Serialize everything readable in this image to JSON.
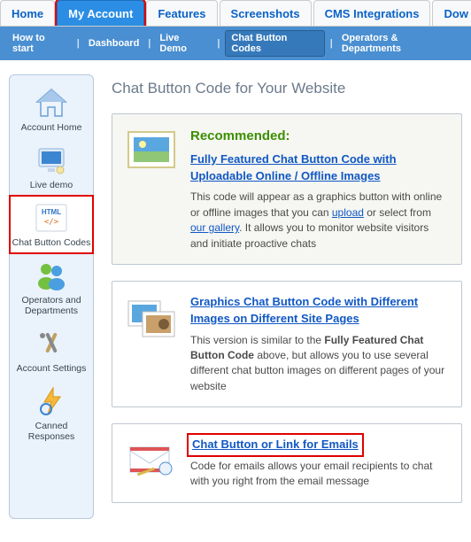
{
  "topnav": {
    "tabs": [
      {
        "label": "Home",
        "active": false
      },
      {
        "label": "My Account",
        "active": true,
        "redbox": true
      },
      {
        "label": "Features",
        "active": false
      },
      {
        "label": "Screenshots",
        "active": false
      },
      {
        "label": "CMS Integrations",
        "active": false
      },
      {
        "label": "Dow",
        "active": false
      }
    ]
  },
  "subnav": {
    "items": [
      {
        "label": "How to start"
      },
      {
        "label": "Dashboard"
      },
      {
        "label": "Live Demo"
      },
      {
        "label": "Chat Button Codes",
        "current": true
      },
      {
        "label": "Operators & Departments"
      }
    ]
  },
  "sidebar": {
    "items": [
      {
        "id": "account-home",
        "label": "Account Home",
        "icon": "home-icon"
      },
      {
        "id": "live-demo",
        "label": "Live demo",
        "icon": "monitor-icon"
      },
      {
        "id": "chat-button-codes",
        "label": "Chat Button Codes",
        "icon": "html-icon",
        "redbox": true
      },
      {
        "id": "operators-departments",
        "label": "Operators and Departments",
        "icon": "users-icon"
      },
      {
        "id": "account-settings",
        "label": "Account Settings",
        "icon": "tools-icon"
      },
      {
        "id": "canned-responses",
        "label": "Canned Responses",
        "icon": "lightning-icon"
      }
    ]
  },
  "main": {
    "title": "Chat Button Code for Your Website",
    "cards": [
      {
        "id": "recommended",
        "recommended_label": "Recommended:",
        "title": "Fully Featured Chat Button Code with Uploadable Online / Offline Images",
        "desc_pre": "This code will appear as a graphics button with online or offline images that you can ",
        "link1": "upload",
        "desc_mid": " or select from ",
        "link2": "our gallery",
        "desc_post": ". It allows you to monitor website visitors and initiate proactive chats"
      },
      {
        "id": "graphics",
        "title": "Graphics Chat Button Code with Different Images on Different Site Pages",
        "desc_pre": "This version is similar to the ",
        "bold": "Fully Featured Chat Button Code",
        "desc_post": " above, but allows you to use several different chat button images on different pages of your website"
      },
      {
        "id": "email",
        "title": "Chat Button or Link for Emails",
        "redbox": true,
        "desc": "Code for emails allows your email recipients to chat with you right from the email message"
      }
    ]
  }
}
